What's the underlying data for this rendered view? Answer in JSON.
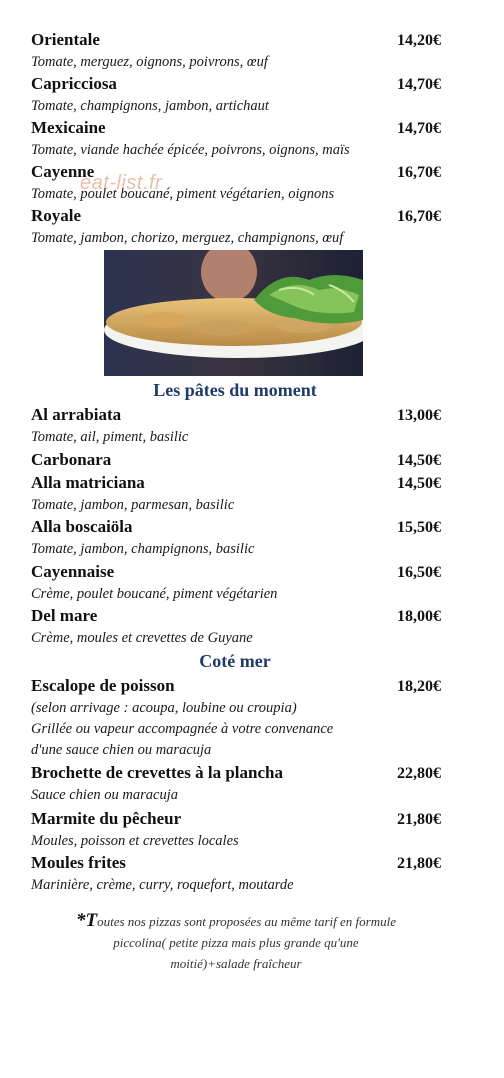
{
  "watermark": "eat-list.fr",
  "items_top": [
    {
      "name": "Orientale",
      "price": "14,20€",
      "desc": "Tomate, merguez, oignons, poivrons, œuf"
    },
    {
      "name": "Capricciosa",
      "price": "14,70€",
      "desc": "Tomate, champignons, jambon, artichaut"
    },
    {
      "name": "Mexicaine",
      "price": "14,70€",
      "desc": "Tomate, viande hachée épicée, poivrons, oignons, maïs"
    },
    {
      "name": "Cayenne",
      "price": "16,70€",
      "desc": "Tomate, poulet boucané, piment végétarien, oignons"
    },
    {
      "name": "Royale",
      "price": "16,70€",
      "desc": "Tomate, jambon, chorizo, merguez, champignons, œuf"
    }
  ],
  "section_pates": {
    "title": "Les pâtes du moment",
    "items": [
      {
        "name": "Al arrabiata",
        "price": "13,00€",
        "desc": "Tomate, ail, piment, basilic"
      },
      {
        "name": "Carbonara",
        "price": "14,50€",
        "desc": ""
      },
      {
        "name": "Alla matriciana",
        "price": "14,50€",
        "desc": "Tomate, jambon, parmesan, basilic"
      },
      {
        "name": "Alla boscaiöla",
        "price": "15,50€",
        "desc": "Tomate, jambon, champignons, basilic"
      },
      {
        "name": "Cayennaise",
        "price": "16,50€",
        "desc": "Crème, poulet boucané, piment végétarien"
      },
      {
        "name": "Del mare",
        "price": "18,00€",
        "desc": "Crème, moules et crevettes de Guyane"
      }
    ]
  },
  "section_mer": {
    "title": "Coté mer",
    "items": [
      {
        "name": "Escalope de poisson",
        "price": "18,20€",
        "desc": "(selon arrivage : acoupa, loubine ou croupia)",
        "desc2": "Grillée ou vapeur accompagnée à votre convenance",
        "desc3": "d'une sauce chien ou maracuja"
      },
      {
        "name": "Brochette de crevettes à la plancha",
        "price": "22,80€",
        "desc": "Sauce chien ou maracuja"
      },
      {
        "name": "Marmite du pêcheur",
        "price": "21,80€",
        "desc": "Moules, poisson et crevettes locales"
      },
      {
        "name": "Moules frites",
        "price": "21,80€",
        "desc": "Marinière, crème, curry, roquefort, moutarde"
      }
    ]
  },
  "footnote": {
    "lead": "*T",
    "line1": "outes nos pizzas sont proposées au même tarif en formule",
    "line2": "piccolina( petite pizza mais plus grande qu'une",
    "line3": "moitié)+salade fraîcheur"
  }
}
